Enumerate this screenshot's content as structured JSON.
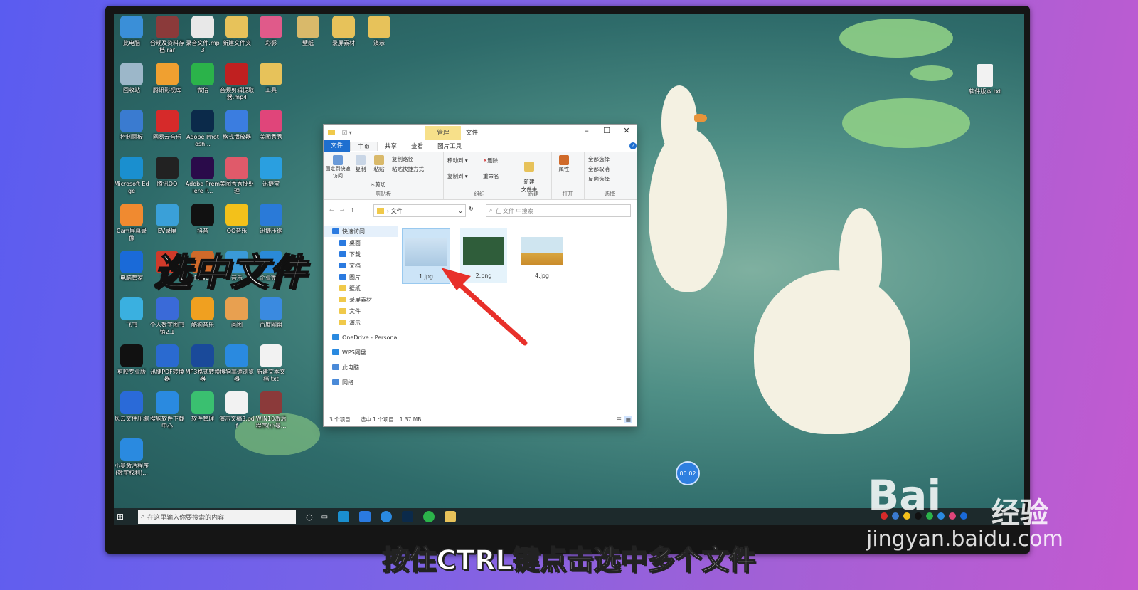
{
  "desktop_icons": [
    {
      "label": "此电脑",
      "color": "#3a8fd8"
    },
    {
      "label": "合规及资料存档.rar",
      "color": "#8b3a3a"
    },
    {
      "label": "录音文件.mp3",
      "color": "#e8e8e8"
    },
    {
      "label": "新建文件夹",
      "color": "#e7c25a"
    },
    {
      "label": "彩影",
      "color": "#e05a8a"
    },
    {
      "label": "壁纸",
      "color": "#d9b96a"
    },
    {
      "label": "录屏素材",
      "color": "#e7c25a"
    },
    {
      "label": "演示",
      "color": "#e7c25a"
    },
    {
      "label": "回收站",
      "color": "#9cb7c9"
    },
    {
      "label": "腾讯影视库",
      "color": "#f0a030"
    },
    {
      "label": "微信",
      "color": "#2bb34a"
    },
    {
      "label": "音频剪辑提取器.mp4",
      "color": "#c02020"
    },
    {
      "label": "工具",
      "color": "#e7c25a"
    },
    {
      "label": "控制面板",
      "color": "#3a7bd0"
    },
    {
      "label": "网易云音乐",
      "color": "#d62a2a"
    },
    {
      "label": "Adobe Photosh...",
      "color": "#0b2a4a"
    },
    {
      "label": "格式播放器",
      "color": "#3b7de0"
    },
    {
      "label": "美图秀秀",
      "color": "#e0457a"
    },
    {
      "label": "Microsoft Edge",
      "color": "#1a8fcf"
    },
    {
      "label": "腾讯QQ",
      "color": "#222222"
    },
    {
      "label": "Adobe Premiere P...",
      "color": "#2a0b4a"
    },
    {
      "label": "美图秀秀批处理",
      "color": "#e05a6a"
    },
    {
      "label": "迅捷宝",
      "color": "#2a9fe0"
    },
    {
      "label": "Cam屏幕录像",
      "color": "#f08a30"
    },
    {
      "label": "EV录屏",
      "color": "#3aa0d8"
    },
    {
      "label": "抖音",
      "color": "#111111"
    },
    {
      "label": "QQ音乐",
      "color": "#f3c11a"
    },
    {
      "label": "迅捷压缩",
      "color": "#2a7ad8"
    },
    {
      "label": "电脑管家",
      "color": "#1a6ad8"
    },
    {
      "label": "WPS",
      "color": "#d03a2a"
    },
    {
      "label": "Power",
      "color": "#d06a2a"
    },
    {
      "label": "音乐",
      "color": "#3a9ad8"
    },
    {
      "label": "企业微信",
      "color": "#2a8ad8"
    },
    {
      "label": "飞书",
      "color": "#3ab0e0"
    },
    {
      "label": "个人数字图书馆2.1",
      "color": "#3a6ad8"
    },
    {
      "label": "酷狗音乐",
      "color": "#f0a020"
    },
    {
      "label": "画图",
      "color": "#e8a050"
    },
    {
      "label": "百度网盘",
      "color": "#3a8ae0"
    },
    {
      "label": "剪映专业版",
      "color": "#111111"
    },
    {
      "label": "迅捷PDF转换器",
      "color": "#2a6ad0"
    },
    {
      "label": "MP3格式转换器",
      "color": "#1a4a9a"
    },
    {
      "label": "搜狗高速浏览器",
      "color": "#2a8ae0"
    },
    {
      "label": "新建文本文档.txt",
      "color": "#f2f2f2"
    },
    {
      "label": "风云文件压缩",
      "color": "#2a6ad8"
    },
    {
      "label": "搜狗软件下载中心",
      "color": "#2a8ae0"
    },
    {
      "label": "软件管理",
      "color": "#3ac070"
    },
    {
      "label": "演示文稿3.pdf",
      "color": "#f2f2f2"
    },
    {
      "label": "WIN10激活程序(小曼...",
      "color": "#8b3a3a"
    },
    {
      "label": "小曼激活程序(数字权利)...",
      "color": "#2a8ae0"
    }
  ],
  "desktop_right_icon": {
    "label": "软件版本.txt"
  },
  "taskbar": {
    "search_placeholder": "在这里输入你要搜索的内容"
  },
  "explorer": {
    "manage_tab": "管理",
    "title": "文件",
    "ribbon_tabs": [
      "文件",
      "主页",
      "共享",
      "查看",
      "图片工具"
    ],
    "groups": {
      "clipboard": {
        "label": "剪贴板",
        "pin": "固定到快速访问",
        "copy": "复制",
        "paste": "粘贴",
        "copy_path": "复制路径",
        "paste_shortcut": "粘贴快捷方式",
        "cut": "剪切"
      },
      "organize": {
        "label": "组织",
        "move_to": "移动到",
        "delete": "删除",
        "copy_to": "复制到",
        "rename": "重命名"
      },
      "new": {
        "label": "新建",
        "new_folder": "新建\n文件夹"
      },
      "open": {
        "label": "打开",
        "properties": "属性"
      },
      "select": {
        "label": "选择",
        "select_all": "全部选择",
        "select_none": "全部取消",
        "invert": "反向选择"
      }
    },
    "address": "文件",
    "search_placeholder": "在 文件 中搜索",
    "nav": [
      {
        "label": "快速访问",
        "type": "star"
      },
      {
        "label": "桌面",
        "type": "blue"
      },
      {
        "label": "下载",
        "type": "blue"
      },
      {
        "label": "文档",
        "type": "blue"
      },
      {
        "label": "图片",
        "type": "blue"
      },
      {
        "label": "壁纸",
        "type": "folder"
      },
      {
        "label": "录屏素材",
        "type": "folder"
      },
      {
        "label": "文件",
        "type": "folder"
      },
      {
        "label": "演示",
        "type": "folder"
      },
      {
        "label": "OneDrive - Persona",
        "type": "cloud"
      },
      {
        "label": "WPS网盘",
        "type": "cloud"
      },
      {
        "label": "此电脑",
        "type": "pc"
      },
      {
        "label": "网络",
        "type": "net"
      }
    ],
    "files": [
      {
        "name": "1.jpg",
        "selected": true
      },
      {
        "name": "2.png",
        "selected": false,
        "hover": true
      },
      {
        "name": "4.jpg",
        "selected": false
      }
    ],
    "status": {
      "count": "3 个项目",
      "selected": "选中 1 个项目",
      "size": "1.37 MB"
    }
  },
  "overlay": {
    "big_caption": "选中文件",
    "bottom_caption": "按住CTRL键点击选中多个文件",
    "timer": "00:02",
    "watermark_a": "Bai",
    "watermark_b": "经验",
    "watermark_url": "jingyan.baidu.com"
  }
}
